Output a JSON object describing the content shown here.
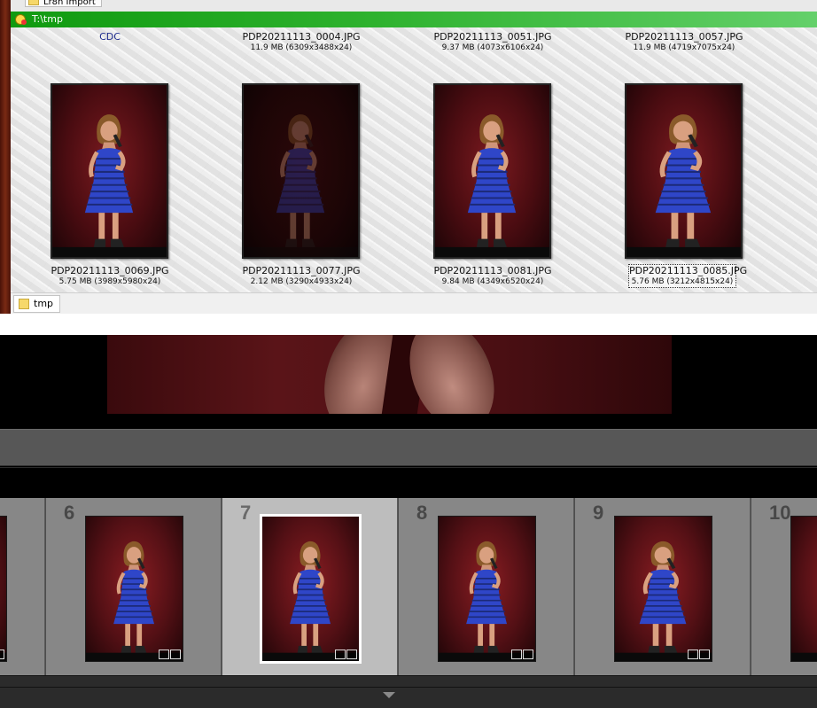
{
  "explorer": {
    "top_folder": "Lr8n Import",
    "path": "T:\\tmp",
    "items": [
      {
        "name": "CDC",
        "info": ""
      },
      {
        "name": "PDP20211113_0004.JPG",
        "info": "11.9 MB (6309x3488x24)"
      },
      {
        "name": "PDP20211113_0051.JPG",
        "info": "9.37 MB (4073x6106x24)"
      },
      {
        "name": "PDP20211113_0057.JPG",
        "info": "11.9 MB (4719x7075x24)"
      },
      {
        "name": "PDP20211113_0069.JPG",
        "info": "5.75 MB (3989x5980x24)"
      },
      {
        "name": "PDP20211113_0077.JPG",
        "info": "2.12 MB (3290x4933x24)"
      },
      {
        "name": "PDP20211113_0081.JPG",
        "info": "9.84 MB (4349x6520x24)"
      },
      {
        "name": "PDP20211113_0085.JPG",
        "info": "5.76 MB (3212x4815x24)"
      }
    ],
    "tab": "tmp"
  },
  "filmstrip": {
    "cells": [
      {
        "num": "6"
      },
      {
        "num": "7",
        "active": true
      },
      {
        "num": "8"
      },
      {
        "num": "9"
      },
      {
        "num": "10"
      }
    ]
  },
  "colors": {
    "path_bar": "#2eb22e",
    "filmstrip_active": "#bdbdbd",
    "filmstrip_cell": "#878787"
  },
  "icons": [
    "folder-icon",
    "location-icon",
    "metadata-badge-icon",
    "edit-badge-icon",
    "collapse-arrow-icon"
  ]
}
